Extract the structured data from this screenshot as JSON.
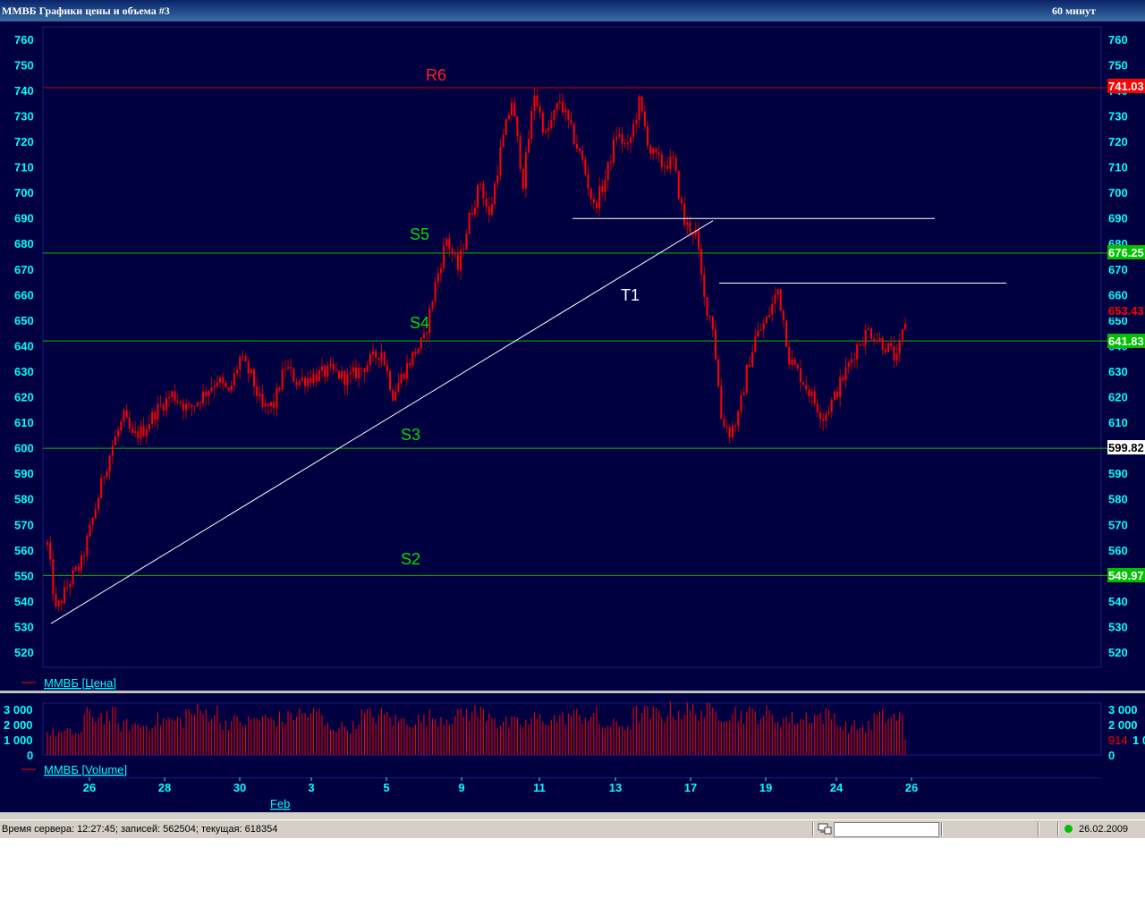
{
  "window": {
    "title": "ММВБ Графики цены и объема #3",
    "interval": "60 минут"
  },
  "statusbar": {
    "server_info": "Время сервера: 12:27:45; записей: 562504; текущая: 618354",
    "date": "26.02.2009",
    "connection_indicator": "green-dot-icon",
    "pc_icon": "computer-icon"
  },
  "colors": {
    "background": "#000040",
    "axis_text": "#00ffff",
    "candle": "#ff0000",
    "support": "#00c000",
    "resistance": "#c00000",
    "drawn_line": "#ffffff"
  },
  "price_panel": {
    "legend": "ММВБ [Цена]",
    "y_ticks": [
      "760",
      "750",
      "740",
      "730",
      "720",
      "710",
      "700",
      "690",
      "680",
      "670",
      "660",
      "650",
      "640",
      "630",
      "620",
      "610",
      "600",
      "590",
      "580",
      "570",
      "560",
      "550",
      "540",
      "530",
      "520"
    ],
    "level_tags": {
      "r6": "741.03",
      "s5": "676.25",
      "last": "653.43",
      "s4": "641.83",
      "s3": "599.82",
      "s2": "549.97"
    },
    "annotations": {
      "r6": "R6",
      "s5": "S5",
      "s4": "S4",
      "s3": "S3",
      "s2": "S2",
      "t1": "T1"
    }
  },
  "volume_panel": {
    "legend": "ММВБ [Volume]",
    "y_ticks": [
      "3 000",
      "2 000",
      "1 000",
      "0"
    ],
    "last_volume": "914"
  },
  "x_axis": {
    "ticks": [
      "26",
      "28",
      "30",
      "3",
      "5",
      "9",
      "11",
      "13",
      "17",
      "19",
      "24",
      "26"
    ],
    "month_label": "Feb"
  },
  "chart_data": {
    "type": "candlestick",
    "title": "",
    "interval": "60 минут",
    "ylim": [
      515,
      765
    ],
    "volume_ylim": [
      0,
      3000
    ],
    "horizontal_levels": [
      {
        "name": "R6",
        "value": 741.03
      },
      {
        "name": "S5",
        "value": 676.25
      },
      {
        "name": "S4",
        "value": 641.83
      },
      {
        "name": "S3",
        "value": 599.82
      },
      {
        "name": "S2",
        "value": 549.97
      }
    ],
    "last_price": 653.43,
    "last_volume": 914,
    "trendline": {
      "name": "T1",
      "from": 534,
      "to": 690
    },
    "price_path": [
      [
        0,
        562
      ],
      [
        3,
        536
      ],
      [
        8,
        548
      ],
      [
        12,
        555
      ],
      [
        16,
        572
      ],
      [
        20,
        590
      ],
      [
        23,
        601
      ],
      [
        27,
        612
      ],
      [
        30,
        604
      ],
      [
        34,
        607
      ],
      [
        38,
        614
      ],
      [
        44,
        621
      ],
      [
        50,
        615
      ],
      [
        56,
        622
      ],
      [
        60,
        627
      ],
      [
        64,
        621
      ],
      [
        68,
        635
      ],
      [
        72,
        628
      ],
      [
        76,
        615
      ],
      [
        80,
        617
      ],
      [
        84,
        632
      ],
      [
        88,
        626
      ],
      [
        94,
        628
      ],
      [
        100,
        630
      ],
      [
        106,
        627
      ],
      [
        112,
        632
      ],
      [
        118,
        638
      ],
      [
        122,
        621
      ],
      [
        126,
        630
      ],
      [
        130,
        638
      ],
      [
        133,
        642
      ],
      [
        137,
        664
      ],
      [
        141,
        682
      ],
      [
        145,
        670
      ],
      [
        149,
        690
      ],
      [
        153,
        704
      ],
      [
        156,
        690
      ],
      [
        160,
        716
      ],
      [
        164,
        736
      ],
      [
        168,
        704
      ],
      [
        172,
        739
      ],
      [
        176,
        722
      ],
      [
        181,
        736
      ],
      [
        185,
        724
      ],
      [
        189,
        712
      ],
      [
        193,
        694
      ],
      [
        197,
        705
      ],
      [
        201,
        723
      ],
      [
        205,
        717
      ],
      [
        209,
        735
      ],
      [
        213,
        716
      ],
      [
        217,
        711
      ],
      [
        221,
        712
      ],
      [
        225,
        688
      ],
      [
        229,
        684
      ],
      [
        232,
        658
      ],
      [
        235,
        648
      ],
      [
        238,
        612
      ],
      [
        241,
        606
      ],
      [
        244,
        612
      ],
      [
        247,
        630
      ],
      [
        250,
        643
      ],
      [
        254,
        650
      ],
      [
        258,
        662
      ],
      [
        260,
        650
      ],
      [
        262,
        635
      ],
      [
        266,
        628
      ],
      [
        270,
        620
      ],
      [
        274,
        612
      ],
      [
        278,
        620
      ],
      [
        282,
        630
      ],
      [
        286,
        640
      ],
      [
        290,
        646
      ],
      [
        294,
        642
      ],
      [
        297,
        639
      ],
      [
        300,
        634
      ],
      [
        303,
        650
      ]
    ],
    "volume_levels": [
      1400,
      2500,
      1900,
      2200,
      2700,
      2100,
      2300,
      2600,
      1800,
      2500,
      2200,
      2400,
      2700,
      2000,
      2300,
      2500,
      1900,
      2600,
      2800,
      2700,
      2600,
      2300,
      2500,
      1800,
      2400
    ]
  }
}
